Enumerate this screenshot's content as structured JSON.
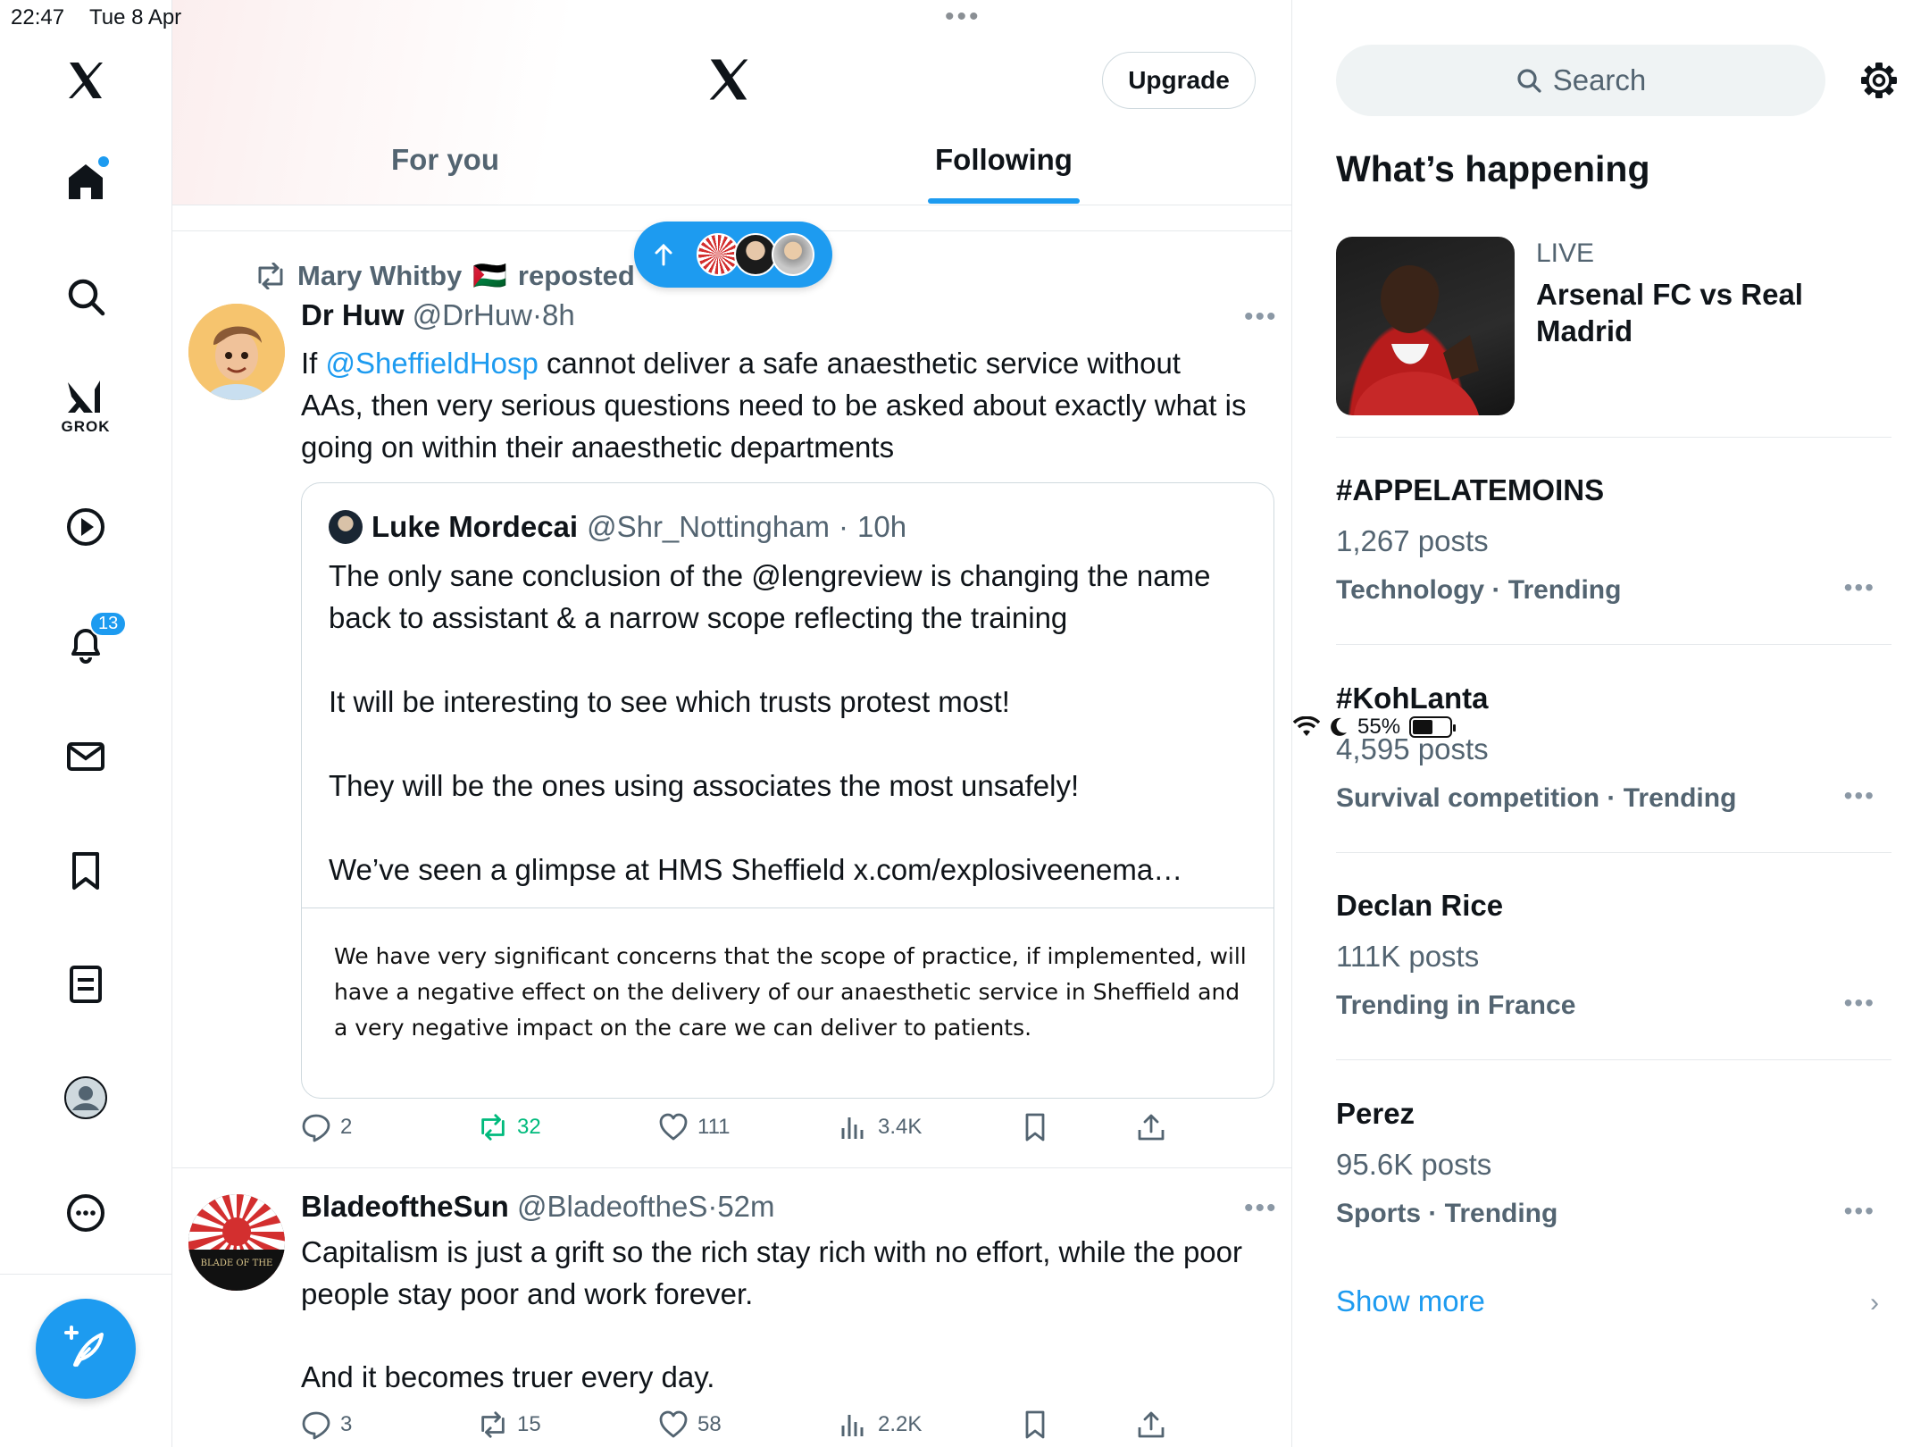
{
  "status_bar": {
    "time": "22:47",
    "date": "Tue 8 Apr",
    "battery": "55%",
    "battery_level": 0.55
  },
  "sidebar": {
    "items": [
      {
        "name": "home",
        "icon": "home-icon",
        "has_dot": true
      },
      {
        "name": "explore",
        "icon": "search-icon"
      },
      {
        "name": "grok",
        "icon": "grok-icon",
        "label": "GROK"
      },
      {
        "name": "video",
        "icon": "play-icon"
      },
      {
        "name": "notifications",
        "icon": "bell-icon",
        "badge": "13"
      },
      {
        "name": "messages",
        "icon": "mail-icon"
      },
      {
        "name": "bookmarks",
        "icon": "bookmark-icon"
      },
      {
        "name": "lists",
        "icon": "list-icon"
      },
      {
        "name": "profile",
        "icon": "avatar-icon"
      },
      {
        "name": "more",
        "icon": "more-icon"
      }
    ],
    "compose_icon": "compose-icon"
  },
  "header": {
    "upgrade_label": "Upgrade",
    "tabs": [
      {
        "label": "For you",
        "active": false
      },
      {
        "label": "Following",
        "active": true
      }
    ]
  },
  "new_posts_pill": {
    "icon": "arrow-up-icon"
  },
  "posts": [
    {
      "repost_by": "Mary Whitby",
      "repost_flag": "🇵🇸",
      "repost_suffix": "reposted",
      "name": "Dr Huw",
      "handle": "@DrHuw",
      "time": "8h",
      "text_prefix": "If ",
      "mention": "@SheffieldHosp",
      "text_rest": " cannot deliver a safe anaesthetic service without AAs, then very serious questions need to be asked about exactly what is going on within their anaesthetic departments",
      "quote": {
        "name": "Luke Mordecai",
        "handle": "@Shr_Nottingham",
        "time": "10h",
        "text": "The only sane conclusion of the @lengreview is changing the name back to assistant & a narrow scope reflecting the training\n\nIt will be interesting to see which trusts protest most!\n\nThey will be the ones using associates the most unsafely!\n\nWe’ve seen a glimpse at HMS Sheffield x.com/explosiveenema…",
        "image_text": "We have very significant concerns that the scope of practice, if implemented, will have a negative effect on the delivery of our anaesthetic service in Sheffield and a very negative impact on the care we can deliver to patients."
      },
      "stats": {
        "replies": "2",
        "reposts": "32",
        "likes": "111",
        "views": "3.4K"
      }
    },
    {
      "name": "BladeoftheSun",
      "handle": "@BladeoftheS",
      "time": "52m",
      "avatar_text": "BLADE OF THE",
      "text_1": "Capitalism is just a grift so the rich stay rich with no effort, while the poor people stay poor and work forever.",
      "text_2": "And it becomes truer every day.",
      "stats": {
        "replies": "3",
        "reposts": "15",
        "likes": "58",
        "views": "2.2K"
      }
    }
  ],
  "right": {
    "search_placeholder": "Search",
    "whats_happening": "What’s happening",
    "live": {
      "label": "LIVE",
      "title": "Arsenal FC vs Real Madrid"
    },
    "trends": [
      {
        "name": "#APPELATEMOINS",
        "count": "1,267 posts",
        "category": "Technology · Trending"
      },
      {
        "name": "#KohLanta",
        "count": "4,595 posts",
        "category": "Survival competition · Trending"
      },
      {
        "name": "Declan Rice",
        "count": "111K posts",
        "category": "Trending in France"
      },
      {
        "name": "Perez",
        "count": "95.6K posts",
        "category": "Sports · Trending"
      }
    ],
    "show_more": "Show more"
  },
  "colors": {
    "accent": "#1d9bf0",
    "repost_green": "#00ba7c",
    "secondary_text": "#536471"
  }
}
